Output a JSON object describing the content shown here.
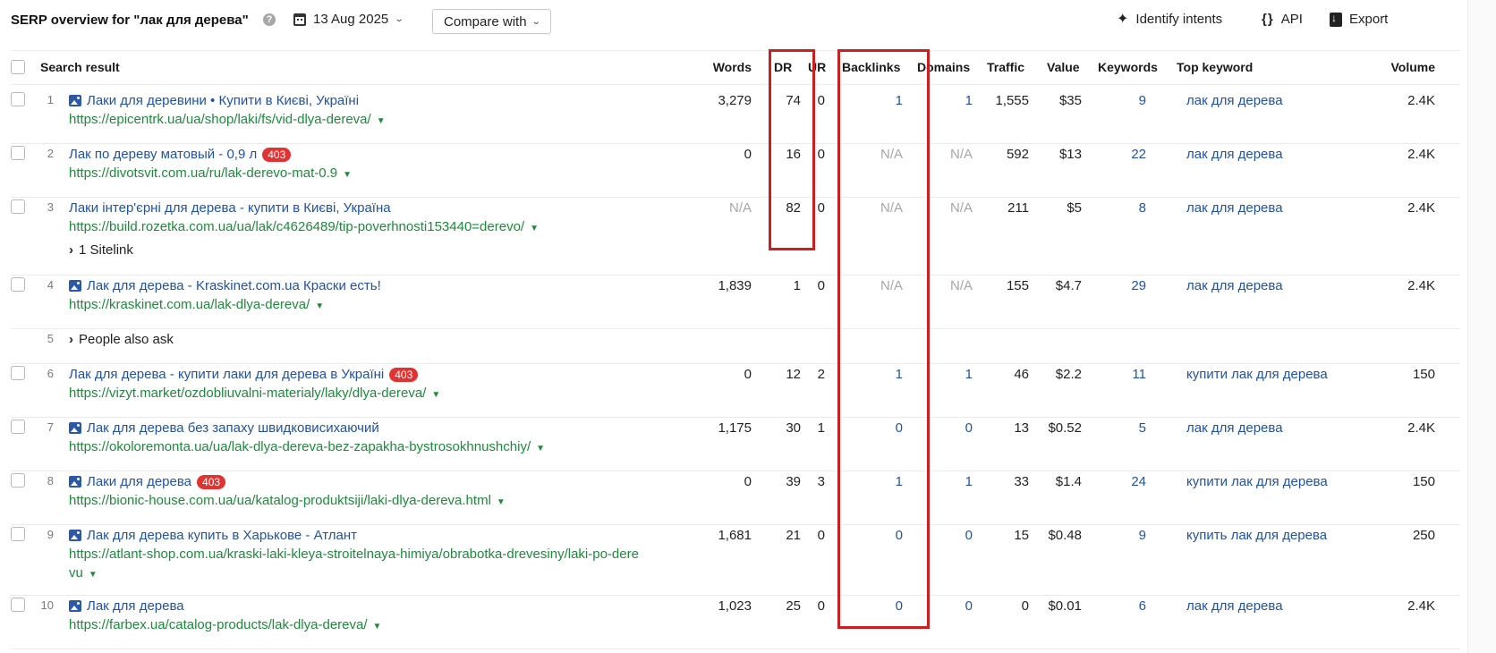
{
  "header": {
    "title": "SERP overview for \"лак для дерева\"",
    "help": "?",
    "date": "13 Aug 2025",
    "compare_label": "Compare with",
    "identify_label": "Identify intents",
    "api_label": "API",
    "export_label": "Export"
  },
  "columns": {
    "search_result": "Search result",
    "words": "Words",
    "dr": "DR",
    "ur": "UR",
    "backlinks": "Backlinks",
    "domains": "Domains",
    "traffic": "Traffic",
    "value": "Value",
    "keywords": "Keywords",
    "top_keyword": "Top keyword",
    "volume": "Volume"
  },
  "rows": [
    {
      "num": "1",
      "title": "Лаки для деревини • Купити в Києві, Україні",
      "url": "https://epicentrk.ua/ua/shop/laki/fs/vid-dlya-dereva/",
      "words": "3,279",
      "dr": "74",
      "ur": "0",
      "backlinks": "1",
      "domains": "1",
      "traffic": "1,555",
      "value": "$35",
      "keywords": "9",
      "top_keyword": "лак для дерева",
      "volume": "2.4K"
    },
    {
      "num": "2",
      "title": "Лак по дереву матовый - 0,9 л",
      "badge": "403",
      "url": "https://divotsvit.com.ua/ru/lak-derevo-mat-0.9",
      "words": "0",
      "dr": "16",
      "ur": "0",
      "backlinks": "N/A",
      "domains": "N/A",
      "traffic": "592",
      "value": "$13",
      "keywords": "22",
      "top_keyword": "лак для дерева",
      "volume": "2.4K"
    },
    {
      "num": "3",
      "title": "Лаки інтер'єрні для дерева - купити в Києві, Україна",
      "url": "https://build.rozetka.com.ua/ua/lak/c4626489/tip-poverhnosti153440=derevo/",
      "sitelink": "1 Sitelink",
      "words": "N/A",
      "dr": "82",
      "ur": "0",
      "backlinks": "N/A",
      "domains": "N/A",
      "traffic": "211",
      "value": "$5",
      "keywords": "8",
      "top_keyword": "лак для дерева",
      "volume": "2.4K"
    },
    {
      "num": "4",
      "title": "Лак для дерева - Kraskinet.com.ua Краски есть!",
      "url": "https://kraskinet.com.ua/lak-dlya-dereva/",
      "words": "1,839",
      "dr": "1",
      "ur": "0",
      "backlinks": "N/A",
      "domains": "N/A",
      "traffic": "155",
      "value": "$4.7",
      "keywords": "29",
      "top_keyword": "лак для дерева",
      "volume": "2.4K"
    },
    {
      "num": "5",
      "paa": "People also ask"
    },
    {
      "num": "6",
      "title": "Лак для дерева - купити лаки для дерева в Україні",
      "badge": "403",
      "url": "https://vizyt.market/ozdobliuvalni-materialy/laky/dlya-dereva/",
      "words": "0",
      "dr": "12",
      "ur": "2",
      "backlinks": "1",
      "domains": "1",
      "traffic": "46",
      "value": "$2.2",
      "keywords": "11",
      "top_keyword": "купити лак для дерева",
      "volume": "150"
    },
    {
      "num": "7",
      "title": "Лак для дерева без запаху швидковисихаючий",
      "url": "https://okoloremonta.ua/ua/lak-dlya-dereva-bez-zapakha-bystrosokhnushchiy/",
      "words": "1,175",
      "dr": "30",
      "ur": "1",
      "backlinks": "0",
      "domains": "0",
      "traffic": "13",
      "value": "$0.52",
      "keywords": "5",
      "top_keyword": "лак для дерева",
      "volume": "2.4K"
    },
    {
      "num": "8",
      "title": "Лаки для дерева",
      "badge": "403",
      "url": "https://bionic-house.com.ua/ua/katalog-produktsiji/laki-dlya-dereva.html",
      "words": "0",
      "dr": "39",
      "ur": "3",
      "backlinks": "1",
      "domains": "1",
      "traffic": "33",
      "value": "$1.4",
      "keywords": "24",
      "top_keyword": "купити лак для дерева",
      "volume": "150"
    },
    {
      "num": "9",
      "title": "Лак для дерева купить в Харькове - Атлант",
      "url": "https://atlant-shop.com.ua/kraski-laki-kleya-stroitelnaya-himiya/obrabotka-drevesiny/laki-po-dere",
      "url_cont": "vu",
      "words": "1,681",
      "dr": "21",
      "ur": "0",
      "backlinks": "0",
      "domains": "0",
      "traffic": "15",
      "value": "$0.48",
      "keywords": "9",
      "top_keyword": "купить лак для дерева",
      "volume": "250"
    },
    {
      "num": "10",
      "title": "Лак для дерева",
      "url": "https://farbex.ua/catalog-products/lak-dlya-dereva/",
      "words": "1,023",
      "dr": "25",
      "ur": "0",
      "backlinks": "0",
      "domains": "0",
      "traffic": "0",
      "value": "$0.01",
      "keywords": "6",
      "top_keyword": "лак для дерева",
      "volume": "2.4K"
    }
  ],
  "colors": {
    "accent_link": "#2252a6",
    "url_green": "#1e8a3c",
    "badge_red": "#e23232",
    "highlight_red": "#cc1f1f"
  }
}
